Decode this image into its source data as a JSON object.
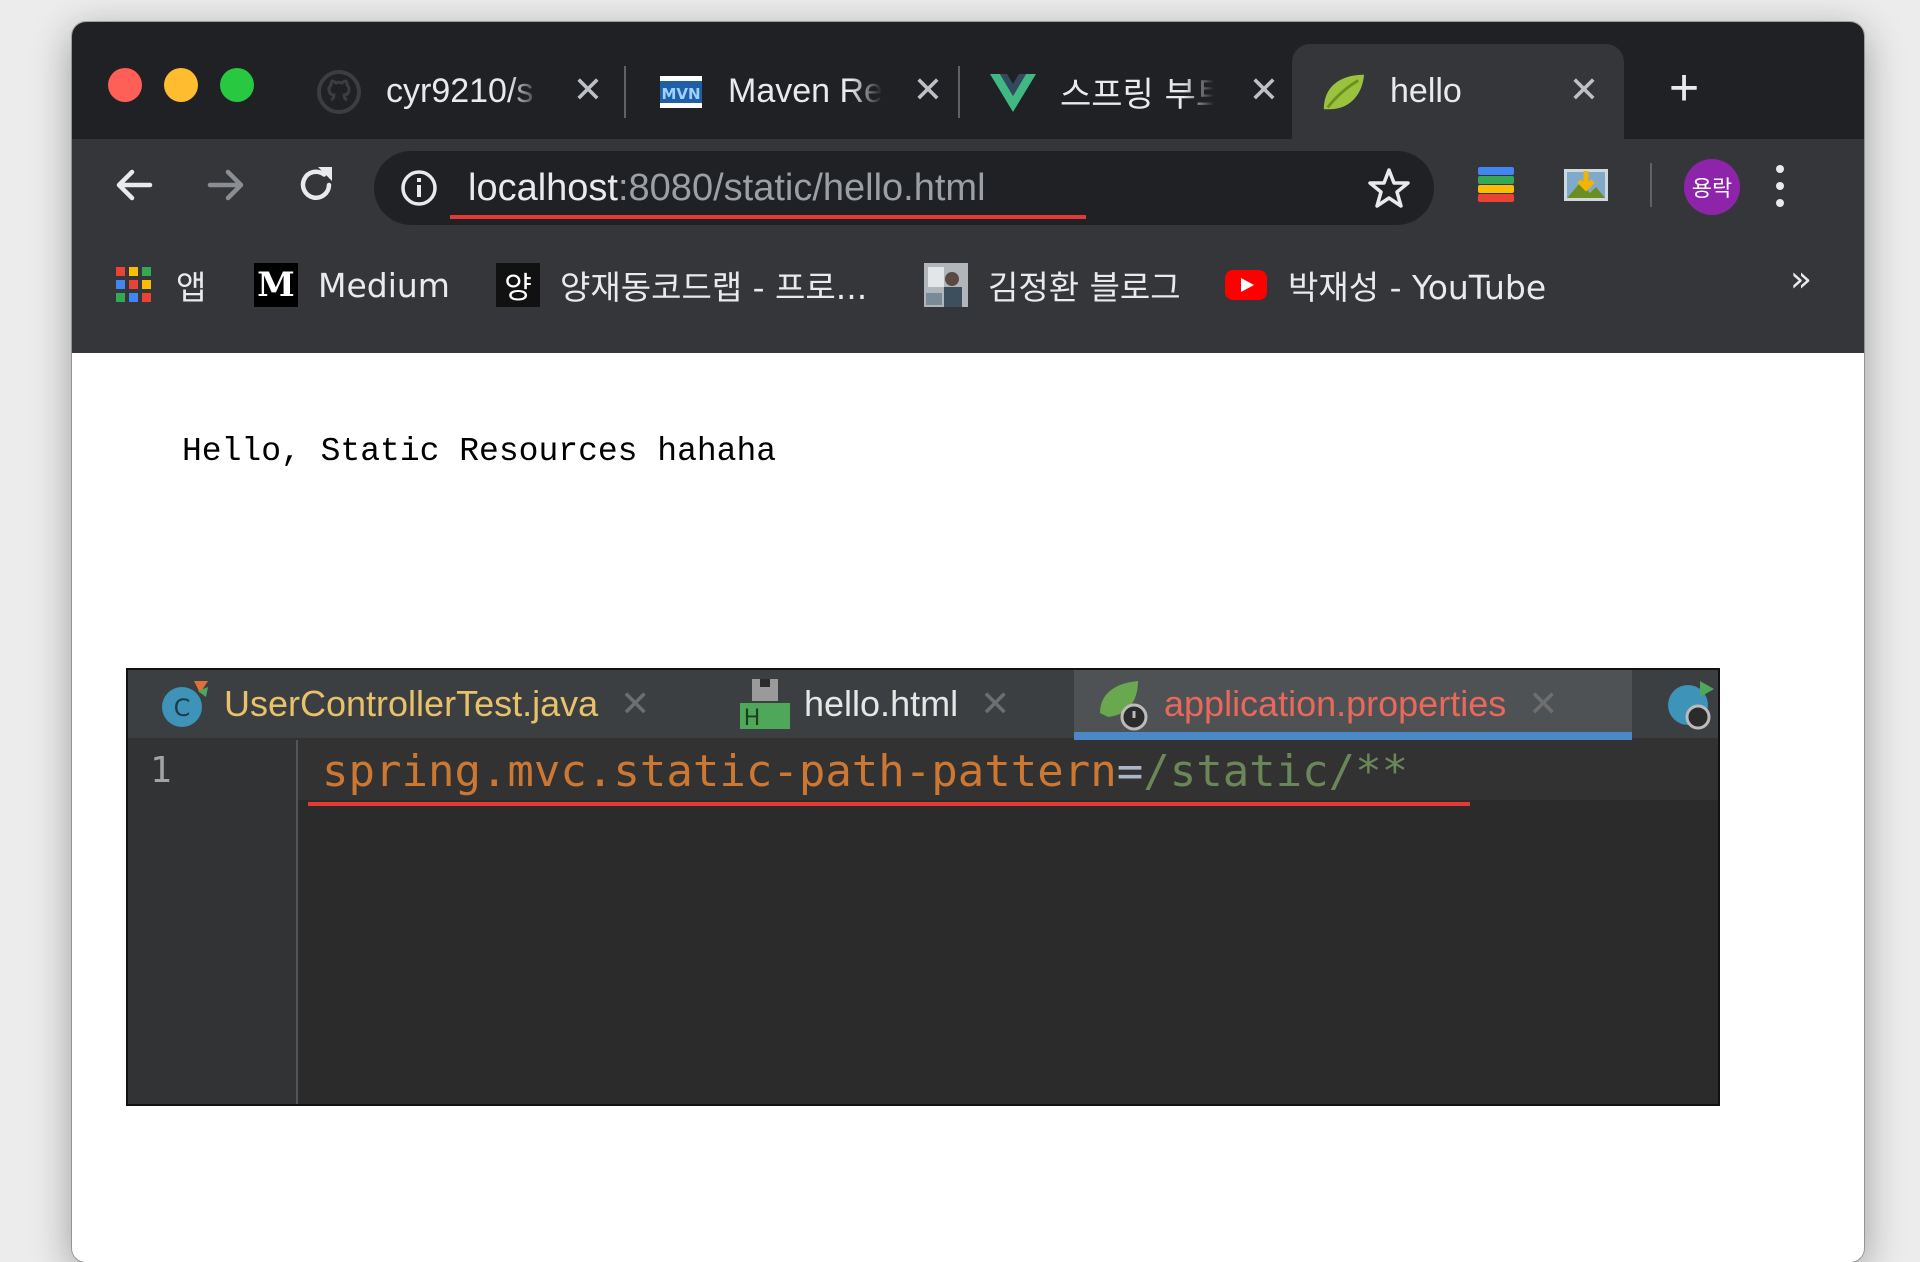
{
  "browser": {
    "tabs": [
      {
        "title": "cyr9210/s",
        "icon": "github-icon"
      },
      {
        "title": "Maven Re",
        "icon": "maven-icon"
      },
      {
        "title": "스프링 부트",
        "icon": "vue-icon"
      },
      {
        "title": "hello",
        "icon": "spring-leaf-icon",
        "active": true
      }
    ],
    "tab_close": "✕",
    "new_tab": "+",
    "url_host": "localhost",
    "url_rest": ":8080/static/hello.html",
    "avatar_text": "용락"
  },
  "bookmarks": {
    "items": [
      {
        "label": "앱",
        "icon": "apps-grid-icon"
      },
      {
        "label": "Medium",
        "icon": "medium-icon"
      },
      {
        "label": "양재동코드랩 - 프로...",
        "icon": "yang-icon"
      },
      {
        "label": "김정환 블로그",
        "icon": "blog-photo-icon"
      },
      {
        "label": "박재성 - YouTube",
        "icon": "youtube-icon"
      }
    ],
    "more": "»",
    "medium_glyph": "M",
    "yang_glyph": "양"
  },
  "page": {
    "text": "Hello, Static Resources hahaha"
  },
  "ide": {
    "tabs": [
      {
        "label": "UserControllerTest.java",
        "color": "#e8c26a"
      },
      {
        "label": "hello.html",
        "color": "#e6e6e6"
      },
      {
        "label": "application.properties",
        "color": "#e8685a",
        "active": true
      }
    ],
    "tab_close": "✕",
    "line_number": "1",
    "code_key": "spring.mvc.static-path-pattern",
    "code_eq": "=",
    "code_val": "/static/**"
  },
  "colors": {
    "accent_underline": "#e53935",
    "ide_tab_indicator": "#4a88c7"
  }
}
